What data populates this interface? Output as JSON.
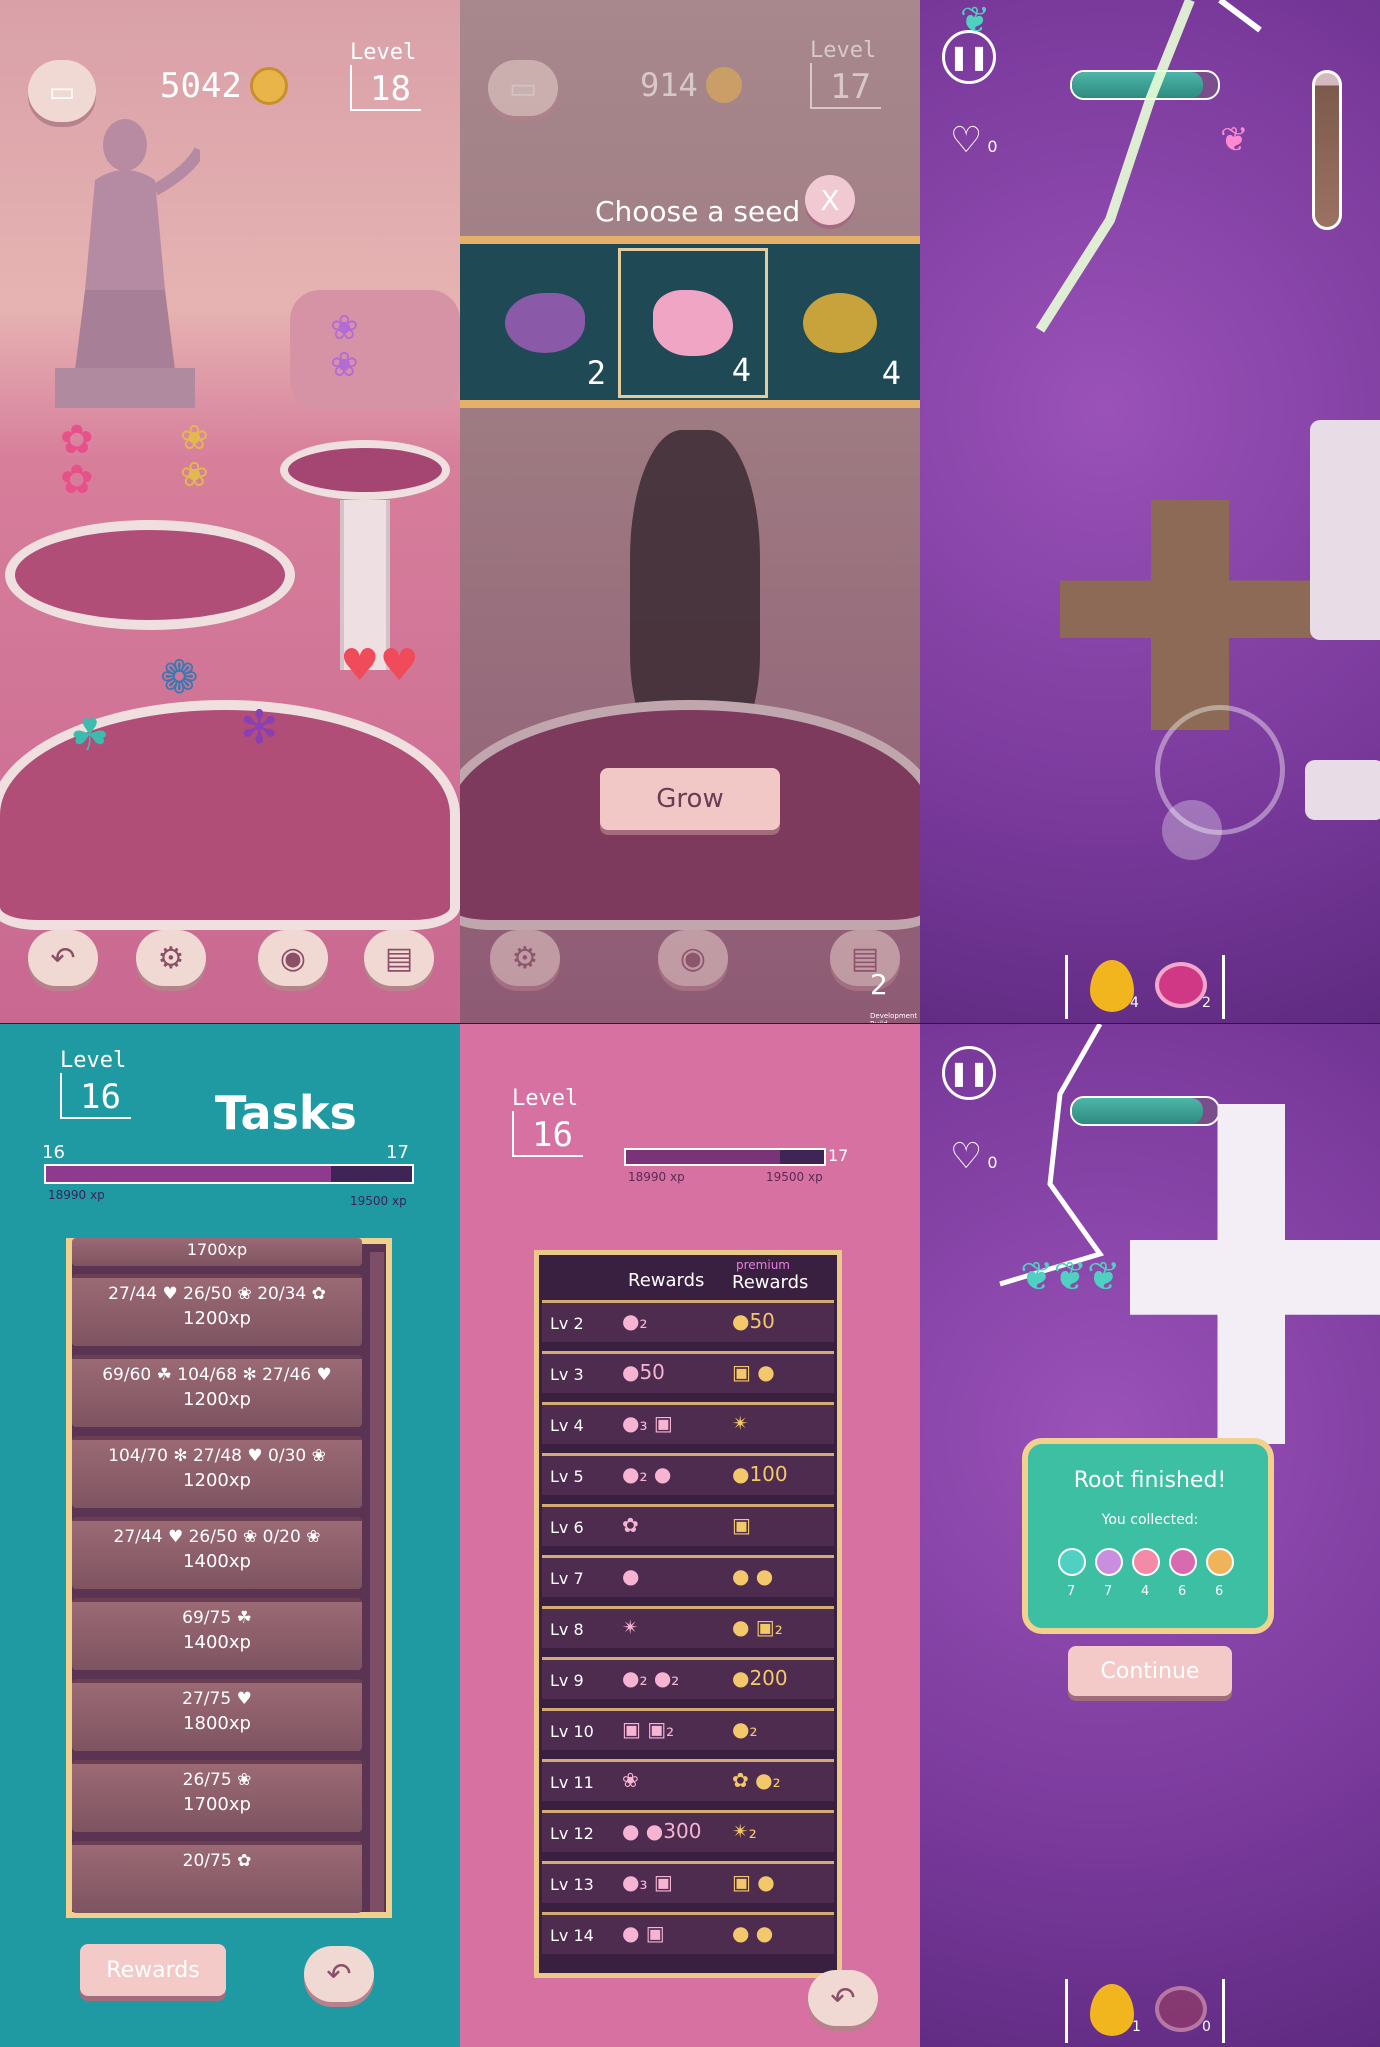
{
  "screen1": {
    "coins": "5042",
    "level_label": "Level",
    "level": "18",
    "icons": [
      "basket-icon",
      "coin-icon",
      "back-icon",
      "gear-icon",
      "seed-bag-icon",
      "scroll-icon"
    ]
  },
  "screen2": {
    "coins": "914",
    "level_label": "Level",
    "level": "17",
    "title": "Choose a seed",
    "close_label": "X",
    "seeds": [
      {
        "icon": "purple-seed-icon",
        "count": "2",
        "color": "#8a5aa8"
      },
      {
        "icon": "pink-seed-icon",
        "count": "4",
        "color": "#f0a5c4"
      },
      {
        "icon": "gold-seed-icon",
        "count": "4",
        "color": "#c8a23a"
      }
    ],
    "grow_label": "Grow",
    "scroll_count": "2",
    "footer": "Development Build"
  },
  "screen3": {
    "hearts": "0",
    "progress": 0.9,
    "inventory": [
      {
        "icon": "gold-droplet-icon",
        "count": "4"
      },
      {
        "icon": "magenta-snail-seed-icon",
        "count": "2"
      }
    ]
  },
  "screen4": {
    "level_label": "Level",
    "level": "16",
    "title": "Tasks",
    "xp_from_level": "16",
    "xp_to_level": "17",
    "xp_current": "18990 xp",
    "xp_target": "19500 xp",
    "xp_fraction": 0.78,
    "partial_top": "1700xp",
    "tasks": [
      {
        "line": "27/44 ♥ 26/50 ❀ 20/34 ✿",
        "xp": "1200xp"
      },
      {
        "line": "69/60 ☘ 104/68 ✻ 27/46 ♥",
        "xp": "1200xp"
      },
      {
        "line": "104/70 ✻ 27/48 ♥ 0/30 ❀",
        "xp": "1200xp"
      },
      {
        "line": "27/44 ♥ 26/50 ❀ 0/20 ❀",
        "xp": "1400xp"
      },
      {
        "line": "69/75 ☘",
        "xp": "1400xp"
      },
      {
        "line": "27/75 ♥",
        "xp": "1800xp"
      },
      {
        "line": "26/75 ❀",
        "xp": "1700xp"
      },
      {
        "line": "20/75 ✿",
        "xp": ""
      }
    ],
    "rewards_label": "Rewards"
  },
  "screen5": {
    "level_label": "Level",
    "level": "16",
    "xp_to_level": "17",
    "xp_current": "18990 xp",
    "xp_target": "19500 xp",
    "xp_fraction": 0.78,
    "col_rewards": "Rewards",
    "col_premium_top": "premium",
    "col_premium": "Rewards",
    "rows": [
      {
        "lv": "Lv 2",
        "r": "●₂",
        "p": "●50"
      },
      {
        "lv": "Lv 3",
        "r": "●50",
        "p": "▣ ●"
      },
      {
        "lv": "Lv 4",
        "r": "●₃ ▣",
        "p": "✴"
      },
      {
        "lv": "Lv 5",
        "r": "●₂ ●",
        "p": "●100"
      },
      {
        "lv": "Lv 6",
        "r": "✿",
        "p": "▣"
      },
      {
        "lv": "Lv 7",
        "r": "●",
        "p": "● ●"
      },
      {
        "lv": "Lv 8",
        "r": "✴",
        "p": "● ▣₂"
      },
      {
        "lv": "Lv 9",
        "r": "●₂ ●₂",
        "p": "●200"
      },
      {
        "lv": "Lv 10",
        "r": "▣ ▣₂",
        "p": "●₂"
      },
      {
        "lv": "Lv 11",
        "r": "❀",
        "p": "✿ ●₂"
      },
      {
        "lv": "Lv 12",
        "r": "● ●300",
        "p": "✴₂"
      },
      {
        "lv": "Lv 13",
        "r": "●₃ ▣",
        "p": "▣ ●"
      },
      {
        "lv": "Lv 14",
        "r": "● ▣",
        "p": "● ●"
      }
    ]
  },
  "screen6": {
    "hearts": "0",
    "progress": 0.9,
    "dialog_title": "Root finished!",
    "dialog_sub": "You collected:",
    "collected": [
      {
        "icon": "clover-icon",
        "count": "7",
        "color": "#4fd0c0"
      },
      {
        "icon": "star-flower-icon",
        "count": "7",
        "color": "#c98ee0"
      },
      {
        "icon": "heart-leaf-icon",
        "count": "4",
        "color": "#f48aa8"
      },
      {
        "icon": "fan-flower-icon",
        "count": "6",
        "color": "#d96ab0"
      },
      {
        "icon": "sun-flower-icon",
        "count": "6",
        "color": "#f1b35a"
      }
    ],
    "continue_label": "Continue",
    "inventory": [
      {
        "icon": "gold-droplet-icon",
        "count": "1"
      },
      {
        "icon": "magenta-snail-seed-icon",
        "count": "0"
      }
    ]
  }
}
